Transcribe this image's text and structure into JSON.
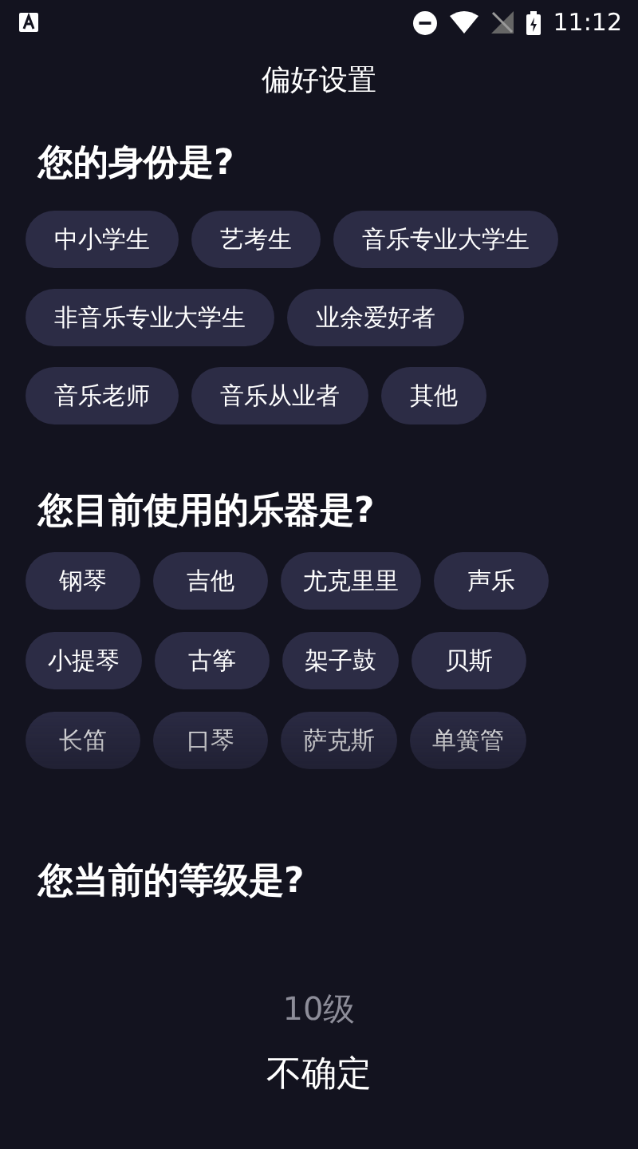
{
  "status_bar": {
    "time": "11:12"
  },
  "title": "偏好设置",
  "sections": [
    {
      "heading": "您的身份是?",
      "options": [
        {
          "label": "中小学生",
          "selected": false
        },
        {
          "label": "艺考生",
          "selected": false
        },
        {
          "label": "音乐专业大学生",
          "selected": false
        },
        {
          "label": "非音乐专业大学生",
          "selected": false
        },
        {
          "label": "业余爱好者",
          "selected": false
        },
        {
          "label": "音乐老师",
          "selected": false
        },
        {
          "label": "音乐从业者",
          "selected": false
        },
        {
          "label": "其他",
          "selected": false
        }
      ]
    },
    {
      "heading": "您目前使用的乐器是?",
      "options": [
        {
          "label": "钢琴",
          "selected": false
        },
        {
          "label": "吉他",
          "selected": false
        },
        {
          "label": "尤克里里",
          "selected": false
        },
        {
          "label": "声乐",
          "selected": false
        },
        {
          "label": "小提琴",
          "selected": false
        },
        {
          "label": "古筝",
          "selected": false
        },
        {
          "label": "架子鼓",
          "selected": false
        },
        {
          "label": "贝斯",
          "selected": false
        },
        {
          "label": "长笛",
          "selected": false
        },
        {
          "label": "口琴",
          "selected": false
        },
        {
          "label": "萨克斯",
          "selected": false
        },
        {
          "label": "单簧管",
          "selected": false
        }
      ]
    }
  ],
  "level": {
    "heading": "您当前的等级是?",
    "items": [
      {
        "label": "10级",
        "selected": false
      },
      {
        "label": "不确定",
        "selected": true
      }
    ]
  }
}
